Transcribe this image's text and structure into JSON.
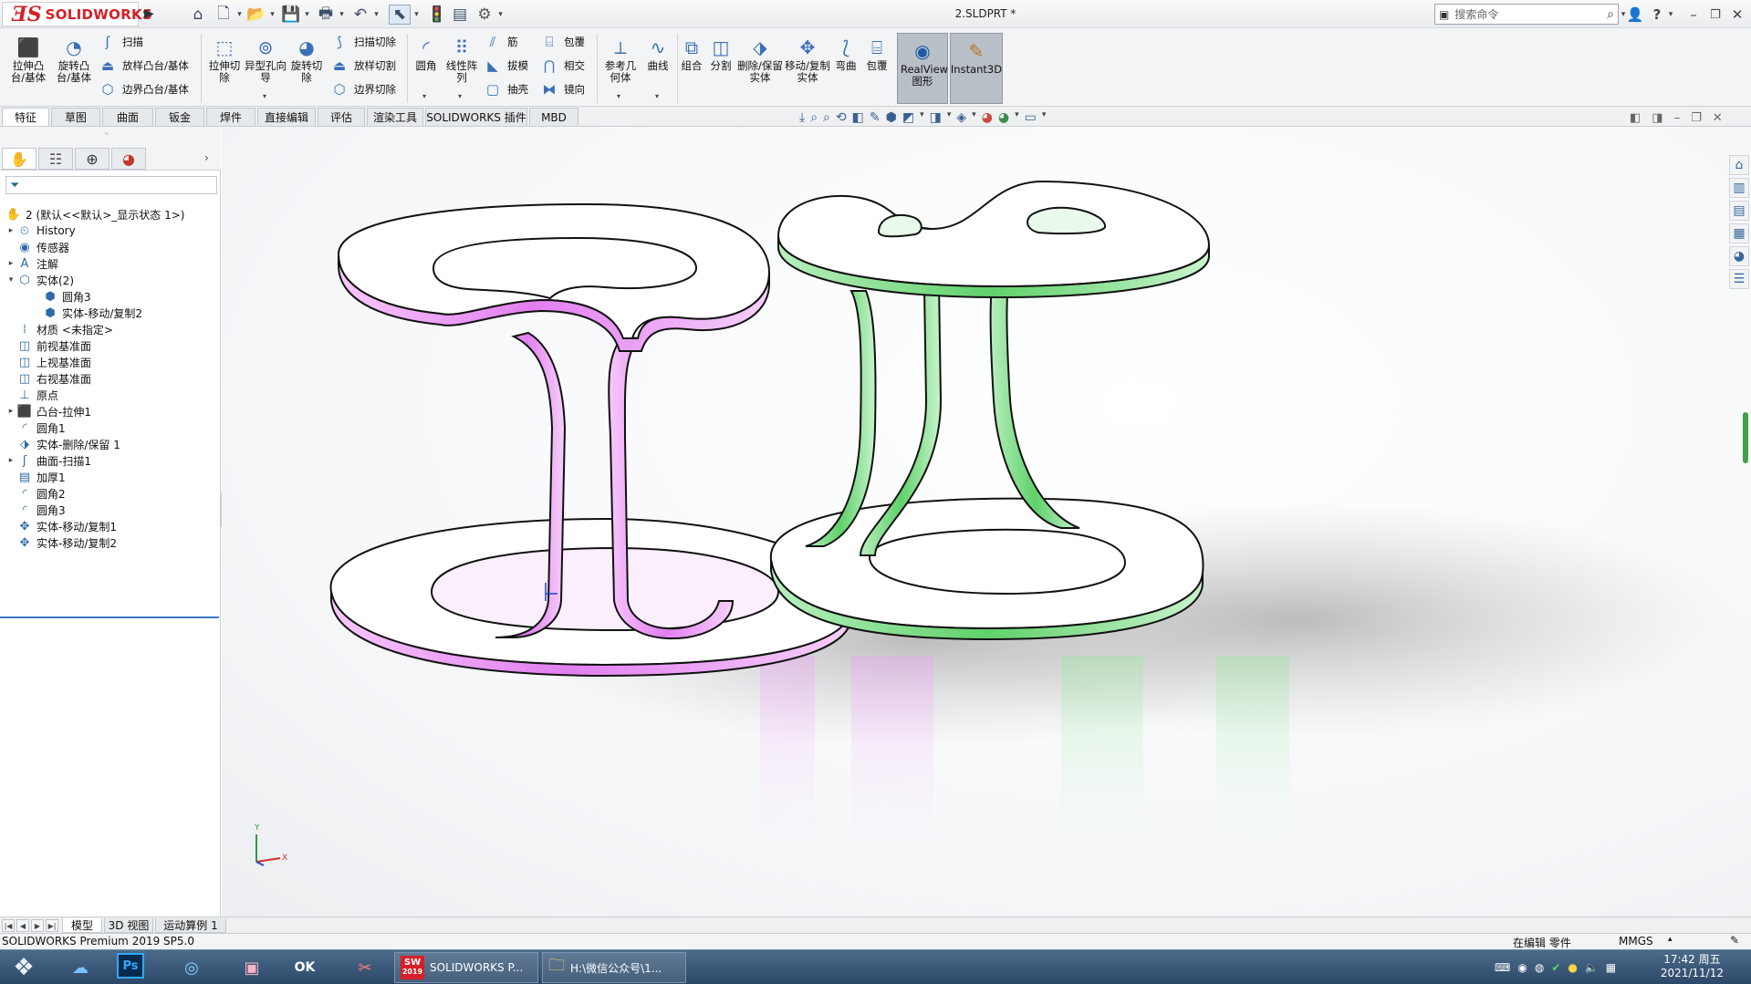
{
  "app": {
    "brand": "SOLIDWORKS",
    "document_title": "2.SLDPRT *",
    "search_placeholder": "搜索命令"
  },
  "ribbon": {
    "extrude_boss": "拉伸凸台/基体",
    "revolve_boss": "旋转凸台/基体",
    "sweep": "扫描",
    "loft_boss": "放样凸台/基体",
    "boundary_boss": "边界凸台/基体",
    "extrude_cut": "拉伸切除",
    "hole_wizard": "异型孔向导",
    "revolve_cut": "旋转切除",
    "swept_cut": "扫描切除",
    "lofted_cut": "放样切割",
    "boundary_cut": "边界切除",
    "fillet": "圆角",
    "linear_pattern": "线性阵列",
    "rib": "筋",
    "draft": "拔模",
    "shell": "抽壳",
    "wrap": "包覆",
    "intersect": "相交",
    "mirror": "镜向",
    "reference_geometry": "参考几何体",
    "curves": "曲线",
    "combine": "组合",
    "split": "分割",
    "delete_keep_body": "删除/保留实体",
    "move_copy_body": "移动/复制实体",
    "flex": "弯曲",
    "wrap2": "包覆",
    "realview": "RealView图形",
    "instant3d": "Instant3D"
  },
  "command_tabs": [
    "特征",
    "草图",
    "曲面",
    "钣金",
    "焊件",
    "直接编辑",
    "评估",
    "渲染工具",
    "SOLIDWORKS 插件",
    "MBD"
  ],
  "tree": {
    "root": "2 (默认<<默认>_显示状态 1>)",
    "items": [
      {
        "label": "History",
        "icon": "history-icon",
        "expandable": true,
        "indent": 1
      },
      {
        "label": "传感器",
        "icon": "sensor-icon",
        "expandable": false,
        "indent": 1
      },
      {
        "label": "注解",
        "icon": "annotation-icon",
        "expandable": true,
        "indent": 1
      },
      {
        "label": "实体(2)",
        "icon": "solid-bodies-icon",
        "expandable": true,
        "indent": 1
      },
      {
        "label": "圆角3",
        "icon": "body-icon",
        "expandable": false,
        "indent": 2
      },
      {
        "label": "实体-移动/复制2",
        "icon": "body-icon",
        "expandable": false,
        "indent": 2
      },
      {
        "label": "材质 <未指定>",
        "icon": "material-icon",
        "expandable": false,
        "indent": 1
      },
      {
        "label": "前视基准面",
        "icon": "plane-icon",
        "expandable": false,
        "indent": 1
      },
      {
        "label": "上视基准面",
        "icon": "plane-icon",
        "expandable": false,
        "indent": 1
      },
      {
        "label": "右视基准面",
        "icon": "plane-icon",
        "expandable": false,
        "indent": 1
      },
      {
        "label": "原点",
        "icon": "origin-icon",
        "expandable": false,
        "indent": 1
      },
      {
        "label": "凸台-拉伸1",
        "icon": "extrude-icon",
        "expandable": true,
        "indent": 1
      },
      {
        "label": "圆角1",
        "icon": "fillet-icon",
        "expandable": false,
        "indent": 1
      },
      {
        "label": "实体-删除/保留 1",
        "icon": "delete-body-icon",
        "expandable": false,
        "indent": 1
      },
      {
        "label": "曲面-扫描1",
        "icon": "surface-sweep-icon",
        "expandable": true,
        "indent": 1
      },
      {
        "label": "加厚1",
        "icon": "thicken-icon",
        "expandable": false,
        "indent": 1
      },
      {
        "label": "圆角2",
        "icon": "fillet-icon",
        "expandable": false,
        "indent": 1
      },
      {
        "label": "圆角3",
        "icon": "fillet-icon",
        "expandable": false,
        "indent": 1
      },
      {
        "label": "实体-移动/复制1",
        "icon": "move-body-icon",
        "expandable": false,
        "indent": 1
      },
      {
        "label": "实体-移动/复制2",
        "icon": "move-body-icon",
        "expandable": false,
        "indent": 1
      }
    ]
  },
  "bottom_tabs": [
    "模型",
    "3D 视图",
    "运动算例 1"
  ],
  "status": {
    "product": "SOLIDWORKS Premium 2019 SP5.0",
    "editing": "在编辑 零件",
    "units": "MMGS"
  },
  "axes": {
    "x": "X",
    "y": "Y"
  },
  "taskbar": {
    "sw_button": "SOLIDWORKS P...",
    "explorer_button": "H:\\微信公众号\\1...",
    "sw_badge": "2019",
    "ok_label": "OK"
  },
  "clock": {
    "time": "17:42 周五",
    "date": "2021/11/12"
  },
  "colors": {
    "brand": "#d52027",
    "accent": "#3a78c3",
    "pink_body": "#e48af0",
    "green_body": "#5fd16a"
  }
}
